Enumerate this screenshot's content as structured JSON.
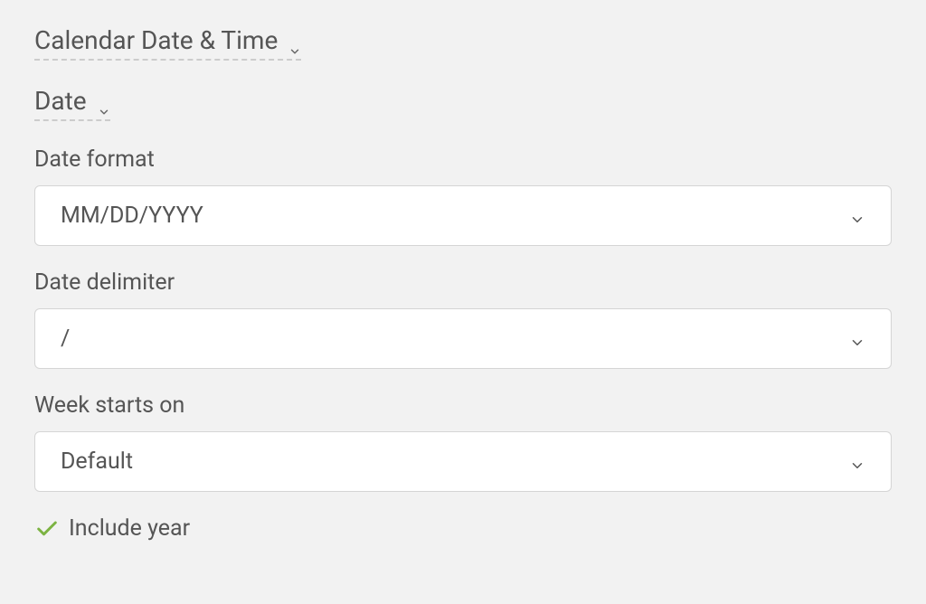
{
  "sections": {
    "main_header": "Calendar Date & Time",
    "sub_header": "Date"
  },
  "fields": {
    "date_format": {
      "label": "Date format",
      "value": "MM/DD/YYYY"
    },
    "date_delimiter": {
      "label": "Date delimiter",
      "value": "/"
    },
    "week_starts": {
      "label": "Week starts on",
      "value": "Default"
    }
  },
  "checkbox": {
    "include_year": {
      "label": "Include year",
      "checked": true
    }
  },
  "colors": {
    "accent": "#7cb342",
    "text": "#555555",
    "border": "#d5d5d5",
    "bg": "#f2f2f2"
  }
}
